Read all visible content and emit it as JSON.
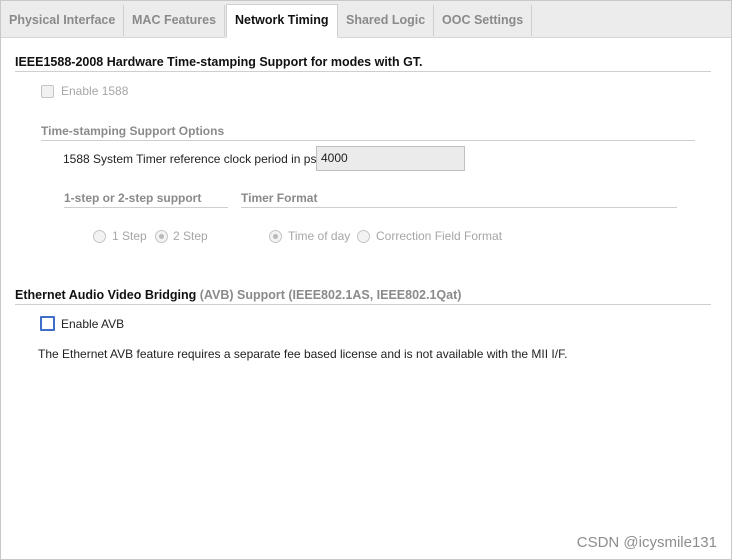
{
  "tabs": [
    {
      "label": "Physical Interface",
      "active": false
    },
    {
      "label": "MAC Features",
      "active": false
    },
    {
      "label": "Network Timing",
      "active": true
    },
    {
      "label": "Shared Logic",
      "active": false
    },
    {
      "label": "OOC Settings",
      "active": false
    }
  ],
  "ieee1588": {
    "title": "IEEE1588-2008 Hardware Time-stamping Support for modes with GT.",
    "enable_label": "Enable 1588",
    "enable_checked": false,
    "options_title": "Time-stamping Support Options",
    "clock_period_label": "1588 System Timer reference clock period in ps",
    "clock_period_value": "4000",
    "step_title": "1-step or 2-step support",
    "step_options": [
      "1 Step",
      "2 Step"
    ],
    "step_selected": "2 Step",
    "timer_title": "Timer Format",
    "timer_options": [
      "Time of day",
      "Correction Field Format"
    ],
    "timer_selected": "Time of day"
  },
  "avb": {
    "title_main": "Ethernet Audio Video Bridging",
    "title_abbrev": "(AVB)",
    "title_rest": "Support (IEEE802.1AS, IEEE802.1Qat)",
    "enable_label": "Enable AVB",
    "enable_checked": false,
    "note": "The Ethernet AVB feature requires a separate fee based license and is not available with the MII I/F."
  },
  "watermark": "CSDN @icysmile131",
  "colors": {
    "focus_border": "#3e6ec7",
    "disabled_text": "#a6a6a6",
    "tab_bar": "#ececec"
  }
}
